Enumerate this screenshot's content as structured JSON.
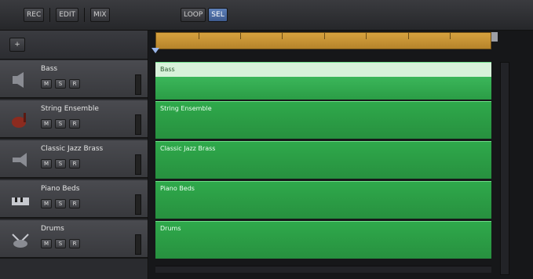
{
  "toolbar": {
    "groups": [
      {
        "label": "REC"
      },
      {
        "label": "EDIT"
      },
      {
        "label": "MIX"
      }
    ],
    "view_label": "LOOP",
    "active_label": "SEL"
  },
  "header_top": {
    "label": "+"
  },
  "tracks": [
    {
      "name": "Bass",
      "clip_label": "Bass",
      "color": "#bfe8c3",
      "buttons": [
        "M",
        "S",
        "R"
      ],
      "icon": "speaker-icon"
    },
    {
      "name": "String Ensemble",
      "clip_label": "String Ensemble",
      "color": "#2fa94b",
      "buttons": [
        "M",
        "S",
        "R"
      ],
      "icon": "violin-icon"
    },
    {
      "name": "Classic Jazz Brass",
      "clip_label": "Classic Jazz Brass",
      "color": "#2fa94b",
      "buttons": [
        "M",
        "S",
        "R"
      ],
      "icon": "horn-icon"
    },
    {
      "name": "Piano Beds",
      "clip_label": "Piano Beds",
      "color": "#2fa94b",
      "buttons": [
        "M",
        "S",
        "R"
      ],
      "icon": "piano-icon"
    },
    {
      "name": "Drums",
      "clip_label": "Drums",
      "color": "#2fa94b",
      "buttons": [
        "M",
        "S",
        "R"
      ],
      "icon": "drum-icon"
    }
  ]
}
